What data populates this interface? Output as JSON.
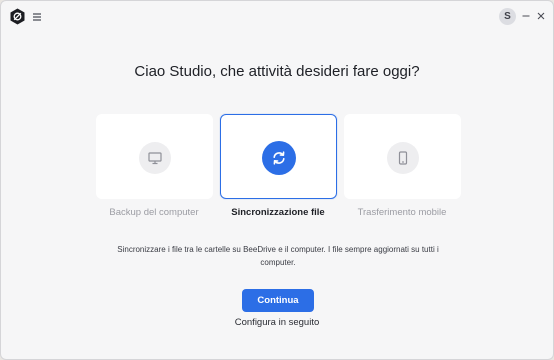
{
  "titlebar": {
    "logo_icon": "beedrive-logo-icon",
    "menu_icon": "hamburger-menu-icon",
    "avatar_initial": "S",
    "minimize_icon": "minimize-icon",
    "close_icon": "close-icon"
  },
  "heading": "Ciao Studio, che attività desideri fare oggi?",
  "options": [
    {
      "label": "Backup del computer",
      "icon": "monitor-icon",
      "selected": false
    },
    {
      "label": "Sincronizzazione file",
      "icon": "sync-icon",
      "selected": true
    },
    {
      "label": "Trasferimento mobile",
      "icon": "smartphone-icon",
      "selected": false
    }
  ],
  "description": "Sincronizzare i file tra le cartelle su BeeDrive e il computer. I file sempre aggiornati su tutti i computer.",
  "continue_label": "Continua",
  "later_label": "Configura in seguito",
  "colors": {
    "accent": "#2c6ee6",
    "background": "#f6f6f7",
    "card": "#ffffff"
  }
}
